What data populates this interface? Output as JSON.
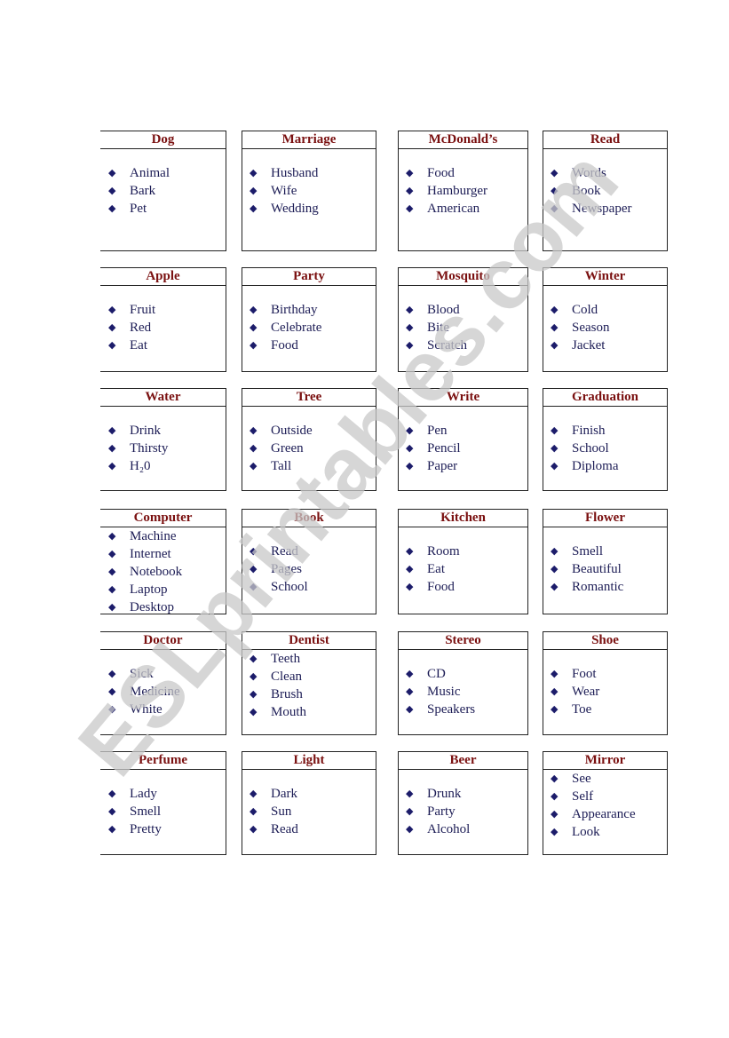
{
  "cards": [
    {
      "title": "Dog",
      "items": [
        "Animal",
        "Bark",
        "Pet"
      ]
    },
    {
      "title": "Marriage",
      "items": [
        "Husband",
        "Wife",
        "Wedding"
      ]
    },
    {
      "title": "McDonald’s",
      "items": [
        "Food",
        "Hamburger",
        "American"
      ]
    },
    {
      "title": "Read",
      "items": [
        "Words",
        "Book",
        "Newspaper"
      ]
    },
    {
      "title": "Apple",
      "items": [
        "Fruit",
        "Red",
        "Eat"
      ]
    },
    {
      "title": "Party",
      "items": [
        "Birthday",
        "Celebrate",
        "Food"
      ]
    },
    {
      "title": "Mosquito",
      "items": [
        "Blood",
        "Bite",
        "Scratch"
      ]
    },
    {
      "title": "Winter",
      "items": [
        "Cold",
        "Season",
        "Jacket"
      ]
    },
    {
      "title": "Water",
      "items": [
        "Drink",
        "Thirsty",
        "H₂0"
      ]
    },
    {
      "title": "Tree",
      "items": [
        "Outside",
        "Green",
        "Tall"
      ]
    },
    {
      "title": "Write",
      "items": [
        "Pen",
        "Pencil",
        "Paper"
      ]
    },
    {
      "title": "Graduation",
      "items": [
        "Finish",
        "School",
        "Diploma"
      ]
    },
    {
      "title": "Computer",
      "items": [
        "Machine",
        "Internet",
        "Notebook",
        "Laptop",
        "Desktop"
      ]
    },
    {
      "title": "Book",
      "items": [
        "Read",
        "Pages",
        "School"
      ]
    },
    {
      "title": "Kitchen",
      "items": [
        "Room",
        "Eat",
        "Food"
      ]
    },
    {
      "title": "Flower",
      "items": [
        "Smell",
        "Beautiful",
        "Romantic"
      ]
    },
    {
      "title": "Doctor",
      "items": [
        "Sick",
        "Medicine",
        "White"
      ]
    },
    {
      "title": "Dentist",
      "items": [
        "Teeth",
        "Clean",
        "Brush",
        "Mouth"
      ]
    },
    {
      "title": "Stereo",
      "items": [
        "CD",
        "Music",
        "Speakers"
      ]
    },
    {
      "title": "Shoe",
      "items": [
        "Foot",
        "Wear",
        "Toe"
      ]
    },
    {
      "title": "Perfume",
      "items": [
        "Lady",
        "Smell",
        "Pretty"
      ]
    },
    {
      "title": "Light",
      "items": [
        "Dark",
        "Sun",
        "Read"
      ]
    },
    {
      "title": "Beer",
      "items": [
        "Drunk",
        "Party",
        "Alcohol"
      ]
    },
    {
      "title": "Mirror",
      "items": [
        "See",
        "Self",
        "Appearance",
        "Look"
      ]
    }
  ],
  "bullet_icon": "diamond-icon",
  "colors": {
    "title": "#7a1010",
    "item": "#1c1c55",
    "watermark": "#c8c8c8"
  },
  "watermark": "ESLprintables.com"
}
